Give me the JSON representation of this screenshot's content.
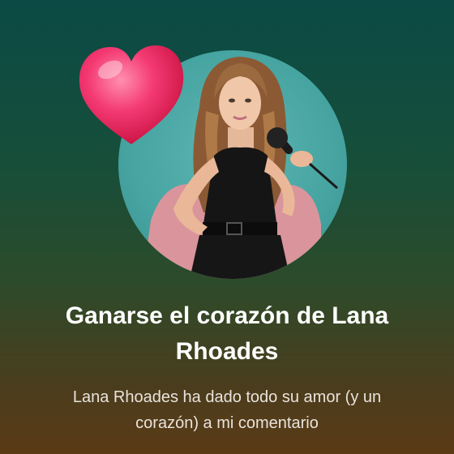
{
  "achievement": {
    "title": "Ganarse el corazón de Lana Rhoades",
    "description": "Lana Rhoades ha dado todo su amor (y un corazón) a mi comentario"
  },
  "badge": {
    "icon": "heart-icon",
    "heart_color": "#f0205e",
    "avatar_background": "#4fadab"
  }
}
